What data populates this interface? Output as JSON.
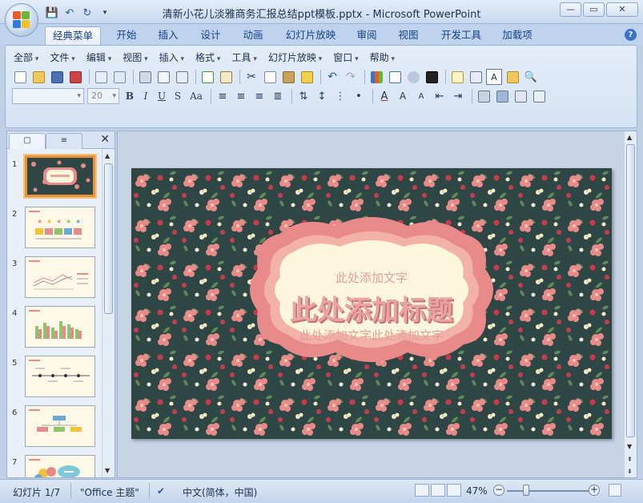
{
  "window": {
    "title": "清新小花儿淡雅商务汇报总结ppt模板.pptx - Microsoft PowerPoint",
    "buttons": {
      "minimize": "—",
      "restore": "▭",
      "close": "✕"
    }
  },
  "quick_access": {
    "save": "💾",
    "undo": "↶",
    "redo": "↻",
    "more": "▾"
  },
  "ribbon_tabs": [
    "经典菜单",
    "开始",
    "插入",
    "设计",
    "动画",
    "幻灯片放映",
    "审阅",
    "视图",
    "开发工具",
    "加载项"
  ],
  "help": "?",
  "menu": [
    "全部",
    "文件",
    "编辑",
    "视图",
    "插入",
    "格式",
    "工具",
    "幻灯片放映",
    "窗口",
    "帮助"
  ],
  "font_size": "20",
  "format_buttons": [
    "B",
    "I",
    "U",
    "S",
    "Aa"
  ],
  "panel": {
    "tab1": "▢",
    "tab2": "≡",
    "close": "✕"
  },
  "slides": [
    {
      "num": "1"
    },
    {
      "num": "2"
    },
    {
      "num": "3"
    },
    {
      "num": "4"
    },
    {
      "num": "5"
    },
    {
      "num": "6"
    },
    {
      "num": "7"
    }
  ],
  "slide": {
    "subtitle_top": "此处添加文字",
    "title": "此处添加标题",
    "subtitle_bottom": "此处添加文字此处添加文字"
  },
  "status": {
    "slide_info": "幻灯片 1/7",
    "theme": "\"Office 主题\"",
    "language": "中文(简体，中国)",
    "zoom": "47%",
    "zoom_minus": "−",
    "zoom_plus": "+"
  },
  "colors": {
    "slide_bg": "#2e4744",
    "frame_outer": "#e98a8a",
    "frame_inner": "#fbf6dc",
    "title_color": "#e9a3a3",
    "accent_orange": "#e8923a"
  }
}
